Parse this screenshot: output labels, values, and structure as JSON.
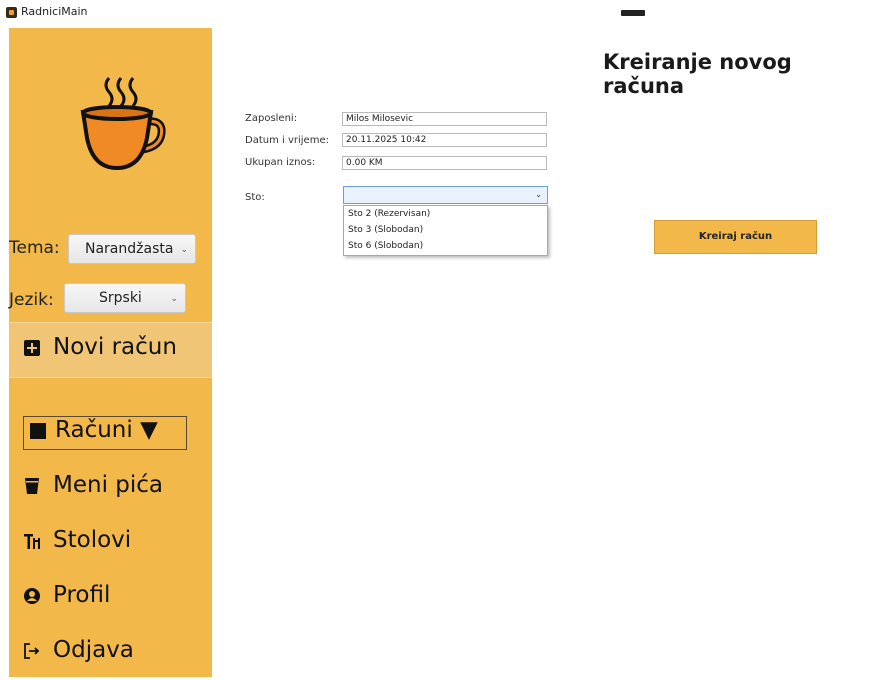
{
  "window": {
    "title": "RadniciMain"
  },
  "sidebar": {
    "theme_label": "Tema:",
    "theme_value": "Narandžasta",
    "language_label": "Jezik:",
    "language_value": "Srpski",
    "nav": [
      {
        "label": "Novi račun",
        "icon": "plus-square-icon",
        "active": true
      },
      {
        "label": "Računi ▼",
        "icon": "square-icon"
      },
      {
        "label": "Meni pića",
        "icon": "glass-icon"
      },
      {
        "label": "Stolovi",
        "icon": "table-icon"
      },
      {
        "label": "Profil",
        "icon": "user-circle-icon"
      },
      {
        "label": "Odjava",
        "icon": "logout-icon"
      }
    ],
    "accent_color": "#f3b84a"
  },
  "main": {
    "title": "Kreiranje novog računa",
    "employee_label": "Zaposleni:",
    "employee_value": "Milos Milosevic",
    "datetime_label": "Datum i vrijeme:",
    "datetime_value": "20.11.2025 10:42",
    "total_label": "Ukupan iznos:",
    "total_value": "0.00 KM",
    "table_label": "Sto:",
    "table_options": [
      "Sto 2 (Rezervisan)",
      "Sto 3 (Slobodan)",
      "Sto 6 (Slobodan)"
    ],
    "create_button": "Kreiraj račun"
  }
}
